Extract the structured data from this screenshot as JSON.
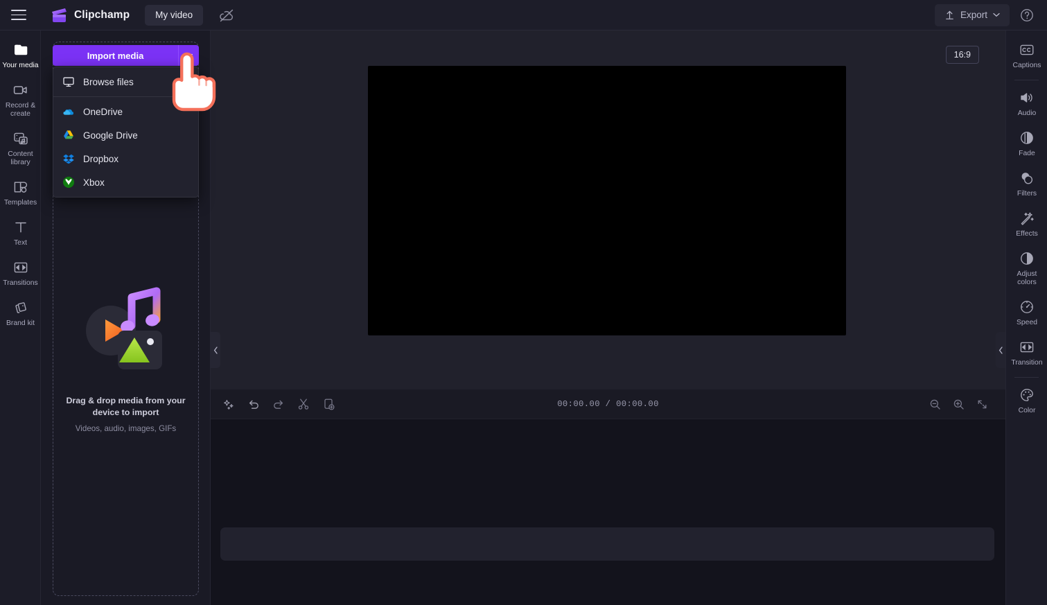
{
  "app": {
    "brand_name": "Clipchamp",
    "document_tab": "My video",
    "hamburger_label": "menu-icon",
    "cloud_status_label": "cloud-off-icon"
  },
  "topbar": {
    "export_label": "Export",
    "export_icon": "upload-icon",
    "export_caret": "chevron-down-icon",
    "help_label": "?"
  },
  "left_rail": {
    "items": [
      {
        "label": "Your media",
        "icon": "folder-icon",
        "active": true
      },
      {
        "label": "Record &\ncreate",
        "icon": "video-camera-icon",
        "active": false
      },
      {
        "label": "Content\nlibrary",
        "icon": "content-library-icon",
        "active": false
      },
      {
        "label": "Templates",
        "icon": "templates-icon",
        "active": false
      },
      {
        "label": "Text",
        "icon": "text-icon",
        "active": false
      },
      {
        "label": "Transitions",
        "icon": "transitions-icon",
        "active": false
      },
      {
        "label": "Brand kit",
        "icon": "brand-kit-icon",
        "active": false
      }
    ]
  },
  "media_panel": {
    "import_button_label": "Import media",
    "import_caret_icon": "chevron-down-icon",
    "menu_items": [
      {
        "label": "Browse files",
        "icon": "monitor-icon"
      },
      {
        "label": "OneDrive",
        "icon": "onedrive-icon"
      },
      {
        "label": "Google Drive",
        "icon": "google-drive-icon"
      },
      {
        "label": "Dropbox",
        "icon": "dropbox-icon"
      },
      {
        "label": "Xbox",
        "icon": "xbox-icon"
      }
    ],
    "empty_title": "Drag & drop media from your device to import",
    "empty_subtitle": "Videos, audio, images, GIFs"
  },
  "preview": {
    "aspect_ratio": "16:9",
    "collapse_left_icon": "chevron-left-icon",
    "collapse_right_icon": "chevron-left-icon"
  },
  "timeline": {
    "current_time": "00:00.00",
    "separator": "/",
    "total_time": "00:00.00",
    "tools": [
      {
        "name": "magic-icon",
        "label": "Auto compose"
      },
      {
        "name": "undo-icon",
        "label": "Undo"
      },
      {
        "name": "redo-icon",
        "label": "Redo"
      },
      {
        "name": "split-icon",
        "label": "Split"
      },
      {
        "name": "add-clip-icon",
        "label": "Add clip"
      }
    ],
    "zoom_tools": [
      {
        "name": "zoom-out-icon",
        "label": "Zoom out"
      },
      {
        "name": "zoom-in-icon",
        "label": "Zoom in"
      },
      {
        "name": "fit-to-screen-icon",
        "label": "Fit to screen"
      }
    ]
  },
  "right_rail": {
    "items": [
      {
        "label": "Captions",
        "icon": "closed-captions-icon"
      },
      {
        "label": "Audio",
        "icon": "speaker-icon"
      },
      {
        "label": "Fade",
        "icon": "fade-icon"
      },
      {
        "label": "Filters",
        "icon": "filters-icon"
      },
      {
        "label": "Effects",
        "icon": "effects-wand-icon"
      },
      {
        "label": "Adjust\ncolors",
        "icon": "adjust-colors-icon"
      },
      {
        "label": "Speed",
        "icon": "speedometer-icon"
      },
      {
        "label": "Transition",
        "icon": "transition-icon"
      },
      {
        "label": "Color",
        "icon": "color-palette-icon"
      }
    ]
  },
  "colors": {
    "accent": "#7b32f5",
    "background": "#15151f",
    "panel": "#1a1a25",
    "cursor_outline": "#f4705a"
  }
}
